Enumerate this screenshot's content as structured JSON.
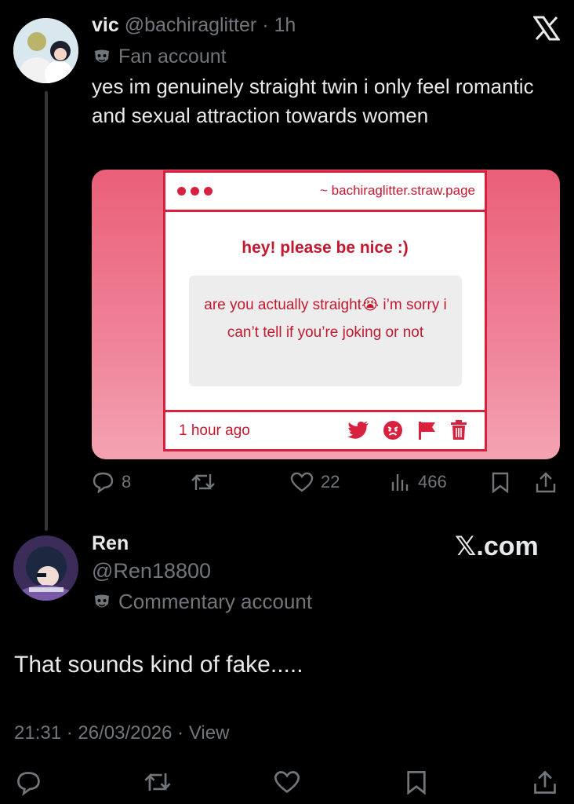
{
  "tweet": {
    "display_name": "vic",
    "handle": "@bachiraglitter",
    "time": "· 1h",
    "label": "Fan account",
    "text": "yes im genuinely straight twin i only feel romantic and sexual attraction towards women",
    "card": {
      "url": "~ bachiraglitter.straw.page",
      "heading": "hey! please be nice :)",
      "question": "are you actually straight😭 i’m sorry i can’t tell if you’re joking or not",
      "time": "1 hour ago"
    },
    "stats": {
      "replies": "8",
      "retweets": "",
      "likes": "22",
      "views": "466"
    }
  },
  "quote": {
    "display_name": "Ren",
    "handle": "@Ren18800",
    "label": "Commentary account",
    "watermark": "𝕏.com",
    "text": "That sounds kind of fake.....",
    "meta": "21:31 · 26/03/2026 · View"
  },
  "icons": [
    "x-logo-icon",
    "mask-icon",
    "reply-icon",
    "retweet-icon",
    "heart-icon",
    "views-icon",
    "bookmark-icon",
    "share-icon",
    "twitter-bird-icon",
    "angry-face-icon",
    "flag-icon",
    "trash-icon"
  ],
  "colors": {
    "background": "#000000",
    "muted": "#71767b",
    "text": "#e7e9ea",
    "card_red": "#d7213f"
  }
}
